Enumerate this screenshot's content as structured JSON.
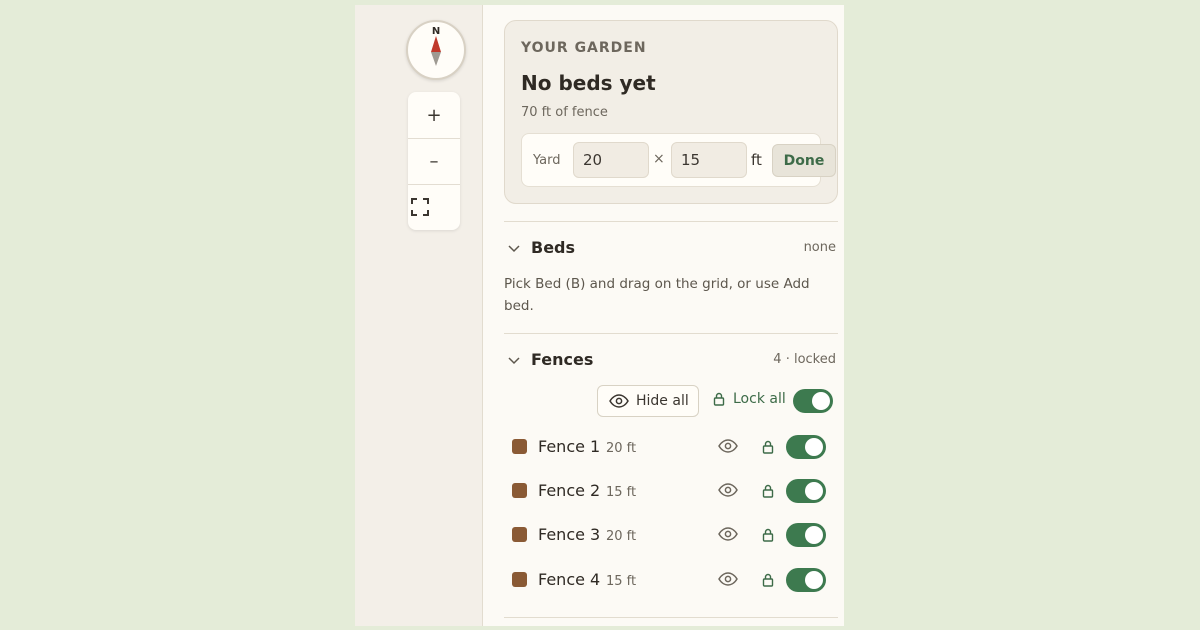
{
  "map": {
    "compass_label": "N",
    "zoom_in": "+",
    "zoom_out": "–"
  },
  "garden": {
    "eyebrow": "YOUR GARDEN",
    "title": "No beds yet",
    "subtitle": "70 ft of fence",
    "yard_label": "Yard",
    "width_value": "20",
    "height_value": "15",
    "times": "×",
    "unit": "ft",
    "done_label": "Done"
  },
  "beds": {
    "title": "Beds",
    "meta": "none",
    "help": "Pick Bed (B) and drag on the grid, or use Add bed."
  },
  "fences": {
    "title": "Fences",
    "meta": "4 · locked",
    "hide_all_label": "Hide all",
    "lock_all_label": "Lock all",
    "lock_all_on": true,
    "items": [
      {
        "name": "Fence 1",
        "length": "20 ft",
        "visible": true,
        "locked": true
      },
      {
        "name": "Fence 2",
        "length": "15 ft",
        "visible": true,
        "locked": true
      },
      {
        "name": "Fence 3",
        "length": "20 ft",
        "visible": true,
        "locked": true
      },
      {
        "name": "Fence 4",
        "length": "15 ft",
        "visible": true,
        "locked": true
      }
    ]
  },
  "colors": {
    "accent": "#3d7a4f",
    "fence_swatch": "#8a5a35",
    "compass_north": "#c0392b"
  }
}
